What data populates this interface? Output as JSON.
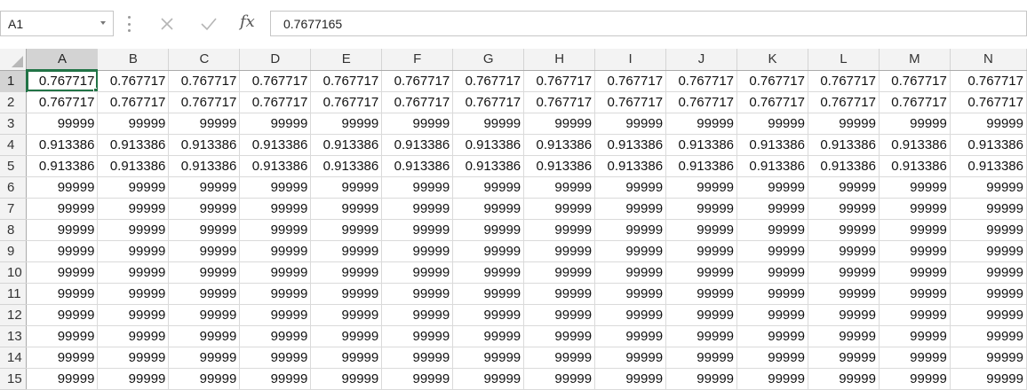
{
  "name_box": {
    "value": "A1"
  },
  "formula_bar": {
    "cancel_icon": "close-icon",
    "enter_icon": "checkmark-icon",
    "fx_label": "fx",
    "value": "0.7677165"
  },
  "grid": {
    "active_cell": "A1",
    "columns": [
      "A",
      "B",
      "C",
      "D",
      "E",
      "F",
      "G",
      "H",
      "I",
      "J",
      "K",
      "L",
      "M",
      "N"
    ],
    "rows": [
      {
        "label": "1",
        "cells": [
          "0.767717",
          "0.767717",
          "0.767717",
          "0.767717",
          "0.767717",
          "0.767717",
          "0.767717",
          "0.767717",
          "0.767717",
          "0.767717",
          "0.767717",
          "0.767717",
          "0.767717",
          "0.767717"
        ]
      },
      {
        "label": "2",
        "cells": [
          "0.767717",
          "0.767717",
          "0.767717",
          "0.767717",
          "0.767717",
          "0.767717",
          "0.767717",
          "0.767717",
          "0.767717",
          "0.767717",
          "0.767717",
          "0.767717",
          "0.767717",
          "0.767717"
        ]
      },
      {
        "label": "3",
        "cells": [
          "99999",
          "99999",
          "99999",
          "99999",
          "99999",
          "99999",
          "99999",
          "99999",
          "99999",
          "99999",
          "99999",
          "99999",
          "99999",
          "99999"
        ]
      },
      {
        "label": "4",
        "cells": [
          "0.913386",
          "0.913386",
          "0.913386",
          "0.913386",
          "0.913386",
          "0.913386",
          "0.913386",
          "0.913386",
          "0.913386",
          "0.913386",
          "0.913386",
          "0.913386",
          "0.913386",
          "0.913386"
        ]
      },
      {
        "label": "5",
        "cells": [
          "0.913386",
          "0.913386",
          "0.913386",
          "0.913386",
          "0.913386",
          "0.913386",
          "0.913386",
          "0.913386",
          "0.913386",
          "0.913386",
          "0.913386",
          "0.913386",
          "0.913386",
          "0.913386"
        ]
      },
      {
        "label": "6",
        "cells": [
          "99999",
          "99999",
          "99999",
          "99999",
          "99999",
          "99999",
          "99999",
          "99999",
          "99999",
          "99999",
          "99999",
          "99999",
          "99999",
          "99999"
        ]
      },
      {
        "label": "7",
        "cells": [
          "99999",
          "99999",
          "99999",
          "99999",
          "99999",
          "99999",
          "99999",
          "99999",
          "99999",
          "99999",
          "99999",
          "99999",
          "99999",
          "99999"
        ]
      },
      {
        "label": "8",
        "cells": [
          "99999",
          "99999",
          "99999",
          "99999",
          "99999",
          "99999",
          "99999",
          "99999",
          "99999",
          "99999",
          "99999",
          "99999",
          "99999",
          "99999"
        ]
      },
      {
        "label": "9",
        "cells": [
          "99999",
          "99999",
          "99999",
          "99999",
          "99999",
          "99999",
          "99999",
          "99999",
          "99999",
          "99999",
          "99999",
          "99999",
          "99999",
          "99999"
        ]
      },
      {
        "label": "10",
        "cells": [
          "99999",
          "99999",
          "99999",
          "99999",
          "99999",
          "99999",
          "99999",
          "99999",
          "99999",
          "99999",
          "99999",
          "99999",
          "99999",
          "99999"
        ]
      },
      {
        "label": "11",
        "cells": [
          "99999",
          "99999",
          "99999",
          "99999",
          "99999",
          "99999",
          "99999",
          "99999",
          "99999",
          "99999",
          "99999",
          "99999",
          "99999",
          "99999"
        ]
      },
      {
        "label": "12",
        "cells": [
          "99999",
          "99999",
          "99999",
          "99999",
          "99999",
          "99999",
          "99999",
          "99999",
          "99999",
          "99999",
          "99999",
          "99999",
          "99999",
          "99999"
        ]
      },
      {
        "label": "13",
        "cells": [
          "99999",
          "99999",
          "99999",
          "99999",
          "99999",
          "99999",
          "99999",
          "99999",
          "99999",
          "99999",
          "99999",
          "99999",
          "99999",
          "99999"
        ]
      },
      {
        "label": "14",
        "cells": [
          "99999",
          "99999",
          "99999",
          "99999",
          "99999",
          "99999",
          "99999",
          "99999",
          "99999",
          "99999",
          "99999",
          "99999",
          "99999",
          "99999"
        ]
      },
      {
        "label": "15",
        "cells": [
          "99999",
          "99999",
          "99999",
          "99999",
          "99999",
          "99999",
          "99999",
          "99999",
          "99999",
          "99999",
          "99999",
          "99999",
          "99999",
          "99999"
        ]
      }
    ]
  },
  "colors": {
    "accent": "#217346",
    "header_bg": "#f3f3f3",
    "selected_header_bg": "#d3d3d3"
  }
}
